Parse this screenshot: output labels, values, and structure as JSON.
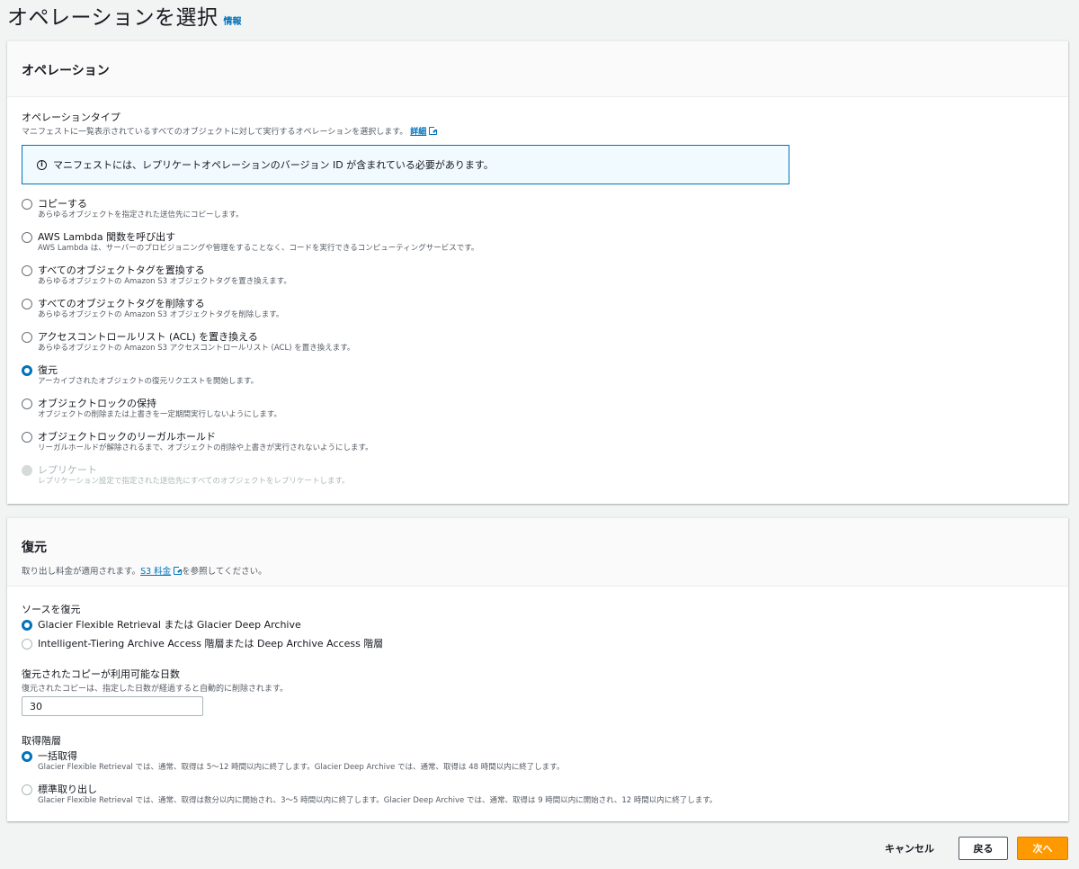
{
  "page": {
    "title": "オペレーションを選択",
    "info_link": "情報"
  },
  "operation_panel": {
    "title": "オペレーション",
    "type_label": "オペレーションタイプ",
    "type_desc": "マニフェストに一覧表示されているすべてのオブジェクトに対して実行するオペレーションを選択します。",
    "type_desc_link": "詳細",
    "alert_icon": "info-icon",
    "alert_text": "マニフェストには、レプリケートオペレーションのバージョン ID が含まれている必要があります。",
    "options": [
      {
        "label": "コピーする",
        "desc": "あらゆるオブジェクトを指定された送信先にコピーします。",
        "selected": false,
        "disabled": false
      },
      {
        "label": "AWS Lambda 関数を呼び出す",
        "desc": "AWS Lambda は、サーバーのプロビジョニングや管理をすることなく、コードを実行できるコンピューティングサービスです。",
        "selected": false,
        "disabled": false
      },
      {
        "label": "すべてのオブジェクトタグを置換する",
        "desc": "あらゆるオブジェクトの Amazon S3 オブジェクトタグを置き換えます。",
        "selected": false,
        "disabled": false
      },
      {
        "label": "すべてのオブジェクトタグを削除する",
        "desc": "あらゆるオブジェクトの Amazon S3 オブジェクトタグを削除します。",
        "selected": false,
        "disabled": false
      },
      {
        "label": "アクセスコントロールリスト (ACL) を置き換える",
        "desc": "あらゆるオブジェクトの Amazon S3 アクセスコントロールリスト (ACL) を置き換えます。",
        "selected": false,
        "disabled": false
      },
      {
        "label": "復元",
        "desc": "アーカイブされたオブジェクトの復元リクエストを開始します。",
        "selected": true,
        "disabled": false
      },
      {
        "label": "オブジェクトロックの保持",
        "desc": "オブジェクトの削除または上書きを一定期間実行しないようにします。",
        "selected": false,
        "disabled": false
      },
      {
        "label": "オブジェクトロックのリーガルホールド",
        "desc": "リーガルホールドが解除されるまで、オブジェクトの削除や上書きが実行されないようにします。",
        "selected": false,
        "disabled": false
      },
      {
        "label": "レプリケート",
        "desc": "レプリケーション設定で指定された送信先にすべてのオブジェクトをレプリケートします。",
        "selected": false,
        "disabled": true
      }
    ]
  },
  "restore_panel": {
    "title": "復元",
    "desc_before": "取り出し料金が適用されます。",
    "desc_link": "S3 料金",
    "desc_after": "を参照してください。",
    "source_label": "ソースを復元",
    "source_options": [
      {
        "label": "Glacier Flexible Retrieval または Glacier Deep Archive",
        "selected": true
      },
      {
        "label": "Intelligent-Tiering Archive Access 階層または Deep Archive Access 階層",
        "selected": false
      }
    ],
    "days_label": "復元されたコピーが利用可能な日数",
    "days_desc": "復元されたコピーは、指定した日数が経過すると自動的に削除されます。",
    "days_value": "30",
    "tier_label": "取得階層",
    "tier_options": [
      {
        "label": "一括取得",
        "desc": "Glacier Flexible Retrieval では、通常、取得は 5～12 時間以内に終了します。Glacier Deep Archive では、通常、取得は 48 時間以内に終了します。",
        "selected": true
      },
      {
        "label": "標準取り出し",
        "desc": "Glacier Flexible Retrieval では、通常、取得は数分以内に開始され、3～5 時間以内に終了します。Glacier Deep Archive では、通常、取得は 9 時間以内に開始され、12 時間以内に終了します。",
        "selected": false
      }
    ]
  },
  "footer": {
    "cancel": "キャンセル",
    "back": "戻る",
    "next": "次へ"
  },
  "colors": {
    "accent": "#0073bb",
    "primary_button": "#ff9900",
    "background": "#f2f3f3"
  }
}
